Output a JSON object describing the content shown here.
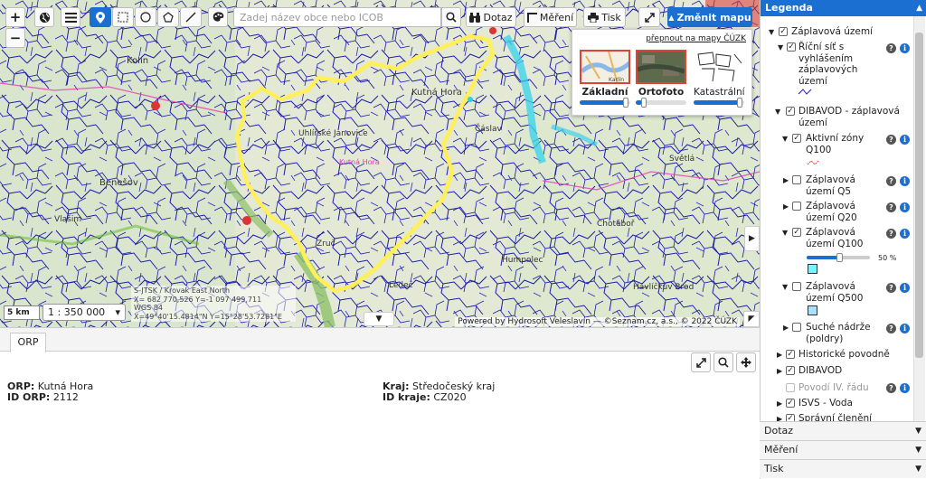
{
  "toolbar": {
    "search_placeholder": "Zadej název obce nebo ICOB",
    "query_label": "Dotaz",
    "measure_label": "Měření",
    "print_label": "Tisk",
    "change_map_label": "Změnit mapu",
    "zoom_in": "+",
    "zoom_out": "−"
  },
  "map_types": {
    "link": "přepnout na mapy ČÚZK",
    "items": [
      {
        "label": "Základní",
        "selected": true,
        "opacity": 1.0
      },
      {
        "label": "Ortofoto",
        "selected": false,
        "opacity": 0.1
      },
      {
        "label": "Katastrální",
        "selected": false,
        "opacity": 1.0
      }
    ],
    "thumb_text": "Karlín"
  },
  "map": {
    "scale_bar": "5 km",
    "scale": "1 : 350 000",
    "coords": [
      "S-JTSK / Krovak East North",
      "X= 682 770,526 Y=-1 097 499,711",
      "WGS 84",
      "X=49°40'15.4814\"N Y=15°28'53.7281\"E"
    ],
    "attribution": "Powered by Hydrosoft Veleslavín  —  ©Seznam.cz, a.s., © 2022 ČÚZK",
    "place_labels": [
      "Kolín",
      "Kutná Hora",
      "Čáslav",
      "Benešov",
      "Vlašim",
      "Havlíčkův Brod",
      "Ledeč",
      "Humpolec",
      "Chotěboř",
      "Světlá",
      "Zruč",
      "Uhlířské Janovice",
      "Kutná Hora"
    ]
  },
  "bottom": {
    "tab": "ORP",
    "orp_key": "ORP:",
    "orp_val": "Kutná Hora",
    "idorp_key": "ID ORP:",
    "idorp_val": "2112",
    "kraj_key": "Kraj:",
    "kraj_val": "Středočeský kraj",
    "idkraj_key": "ID kraje:",
    "idkraj_val": "CZ020"
  },
  "legend": {
    "title": "Legenda",
    "items": {
      "zaplavova_uzemi": "Záplavová území",
      "ricni_sit": [
        "Říční síť s",
        "vyhlášením",
        "záplavových",
        "území"
      ],
      "dibavod_zu": [
        "DIBAVOD - záplavová",
        "území"
      ],
      "aktivni_zony": [
        "Aktivní zóny",
        "Q100"
      ],
      "q5": [
        "Záplavová",
        "území Q5"
      ],
      "q20": [
        "Záplavová",
        "území Q20"
      ],
      "q100": [
        "Záplavová",
        "území Q100"
      ],
      "opacity_label": "50 %",
      "q500": [
        "Záplavová",
        "území Q500"
      ],
      "suche": [
        "Suché nádrže",
        "(poldry)"
      ],
      "historicke": "Historické povodně",
      "dibavod": "DIBAVOD",
      "povodi": "Povodí IV. řádu",
      "isvs": "ISVS - Voda",
      "spravni": "Správní členění"
    }
  },
  "accordion": [
    "Dotaz",
    "Měření",
    "Tisk"
  ],
  "colors": {
    "accent": "#1a6fd1",
    "river": "#1c1ca8",
    "boundary": "#ffef5a"
  }
}
